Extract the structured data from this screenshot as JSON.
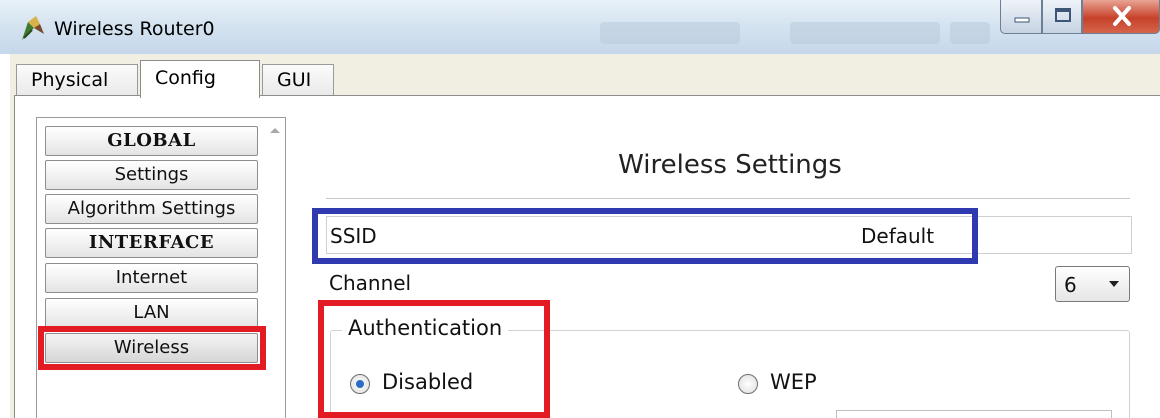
{
  "window": {
    "title": "Wireless Router0",
    "icons": {
      "app": "router-icon",
      "minimize": "minimize-icon",
      "maximize": "maximize-icon",
      "close": "close-icon"
    }
  },
  "tabs": [
    {
      "label": "Physical",
      "active": false
    },
    {
      "label": "Config",
      "active": true
    },
    {
      "label": "GUI",
      "active": false
    }
  ],
  "sidebar": {
    "items": [
      {
        "label": "GLOBAL",
        "kind": "header"
      },
      {
        "label": "Settings",
        "kind": "item"
      },
      {
        "label": "Algorithm Settings",
        "kind": "item"
      },
      {
        "label": "INTERFACE",
        "kind": "header"
      },
      {
        "label": "Internet",
        "kind": "item"
      },
      {
        "label": "LAN",
        "kind": "item"
      },
      {
        "label": "Wireless",
        "kind": "item",
        "selected": true
      }
    ]
  },
  "main": {
    "title": "Wireless Settings",
    "ssid": {
      "label": "SSID",
      "value": "Default"
    },
    "channel": {
      "label": "Channel",
      "value": "6"
    },
    "authentication": {
      "legend": "Authentication",
      "options": [
        {
          "label": "Disabled",
          "checked": true
        },
        {
          "label": "WEP",
          "checked": false
        }
      ]
    }
  },
  "annotations": {
    "colors": {
      "red": "#e31b23",
      "blue": "#2f3ab0"
    }
  }
}
